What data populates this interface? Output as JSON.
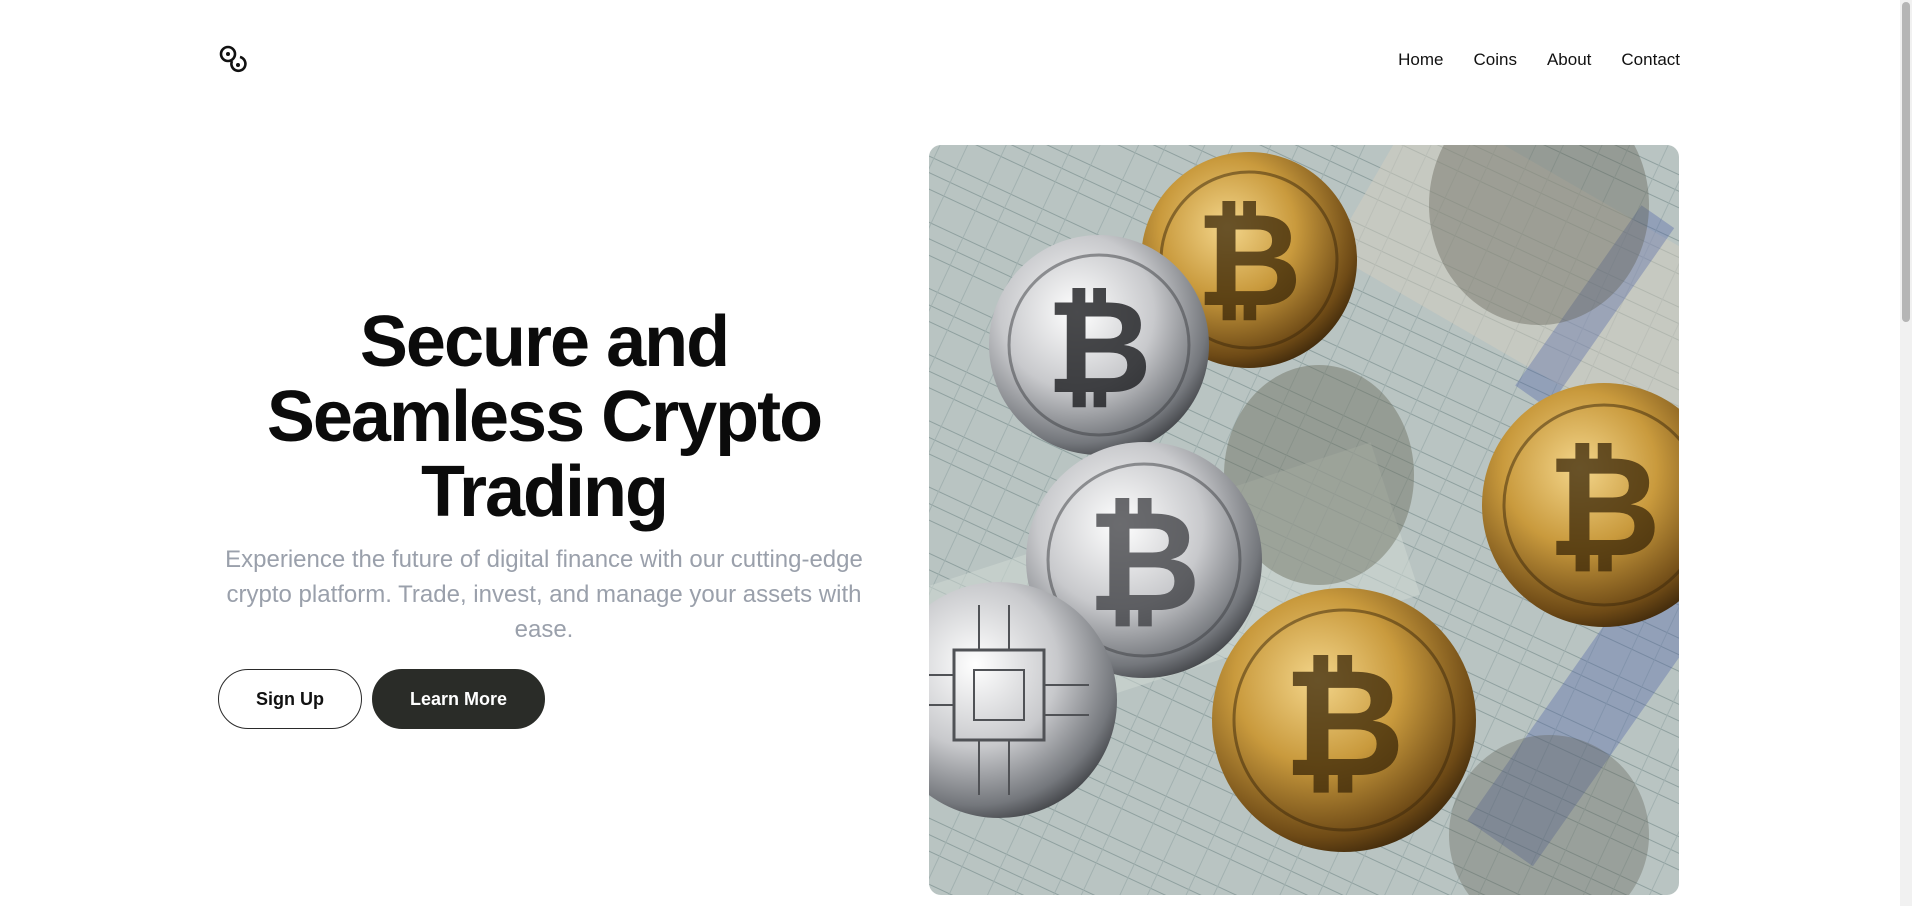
{
  "header": {
    "logo_icon": "coins-logo-icon",
    "nav": [
      {
        "label": "Home"
      },
      {
        "label": "Coins"
      },
      {
        "label": "About"
      },
      {
        "label": "Contact"
      }
    ]
  },
  "hero": {
    "title_line_1": "Secure and",
    "title_line_2": "Seamless Crypto",
    "title_line_3": "Trading",
    "subtitle": "Experience the future of digital finance with our cutting-edge crypto platform. Trade, invest, and manage your assets with ease.",
    "signup_label": "Sign Up",
    "learn_more_label": "Learn More",
    "image_alt": "Gold and silver bitcoin coins on US dollar bills"
  },
  "colors": {
    "primary_dark": "#2a2c28",
    "subtitle_gray": "#9aa0ab",
    "text": "#0b0b0b"
  }
}
